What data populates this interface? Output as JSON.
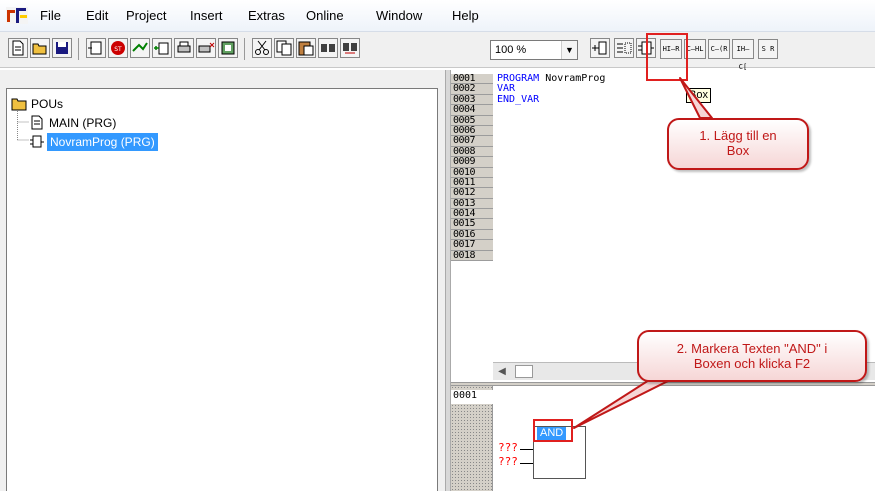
{
  "menubar": {
    "items": [
      "File",
      "Edit",
      "Project",
      "Insert",
      "Extras",
      "Online",
      "Window",
      "Help"
    ]
  },
  "toolbar": {
    "zoom_value": "100 %",
    "ld_buttons": [
      "HI—R",
      "C—HL",
      "C—(R",
      "IH—C[",
      "S R"
    ]
  },
  "pou_tree": {
    "root_label": "POUs",
    "items": [
      {
        "label": "MAIN (PRG)"
      },
      {
        "label": "NovramProg (PRG)"
      }
    ]
  },
  "declaration": {
    "line_numbers": [
      "0001",
      "0002",
      "0003",
      "0004",
      "0005",
      "0006",
      "0007",
      "0008",
      "0009",
      "0010",
      "0011",
      "0012",
      "0013",
      "0014",
      "0015",
      "0016",
      "0017",
      "0018"
    ],
    "keyword_program": "PROGRAM",
    "program_name": "NovramProg",
    "keyword_var": "VAR",
    "keyword_end_var": "END_VAR"
  },
  "body": {
    "line_number": "0001",
    "box_type": "AND",
    "input_placeholder": "???"
  },
  "tooltip": {
    "text": "Box"
  },
  "annotations": {
    "callout1_line1": "1. Lägg till en",
    "callout1_line2": "Box",
    "callout2_line1": "2. Markera Texten \"AND\" i",
    "callout2_line2": "Boxen och klicka F2"
  },
  "colors": {
    "selection": "#3399ff",
    "annotation_red": "#c01818",
    "keyword_blue": "#0000ff",
    "placeholder_red": "#ff0000"
  }
}
